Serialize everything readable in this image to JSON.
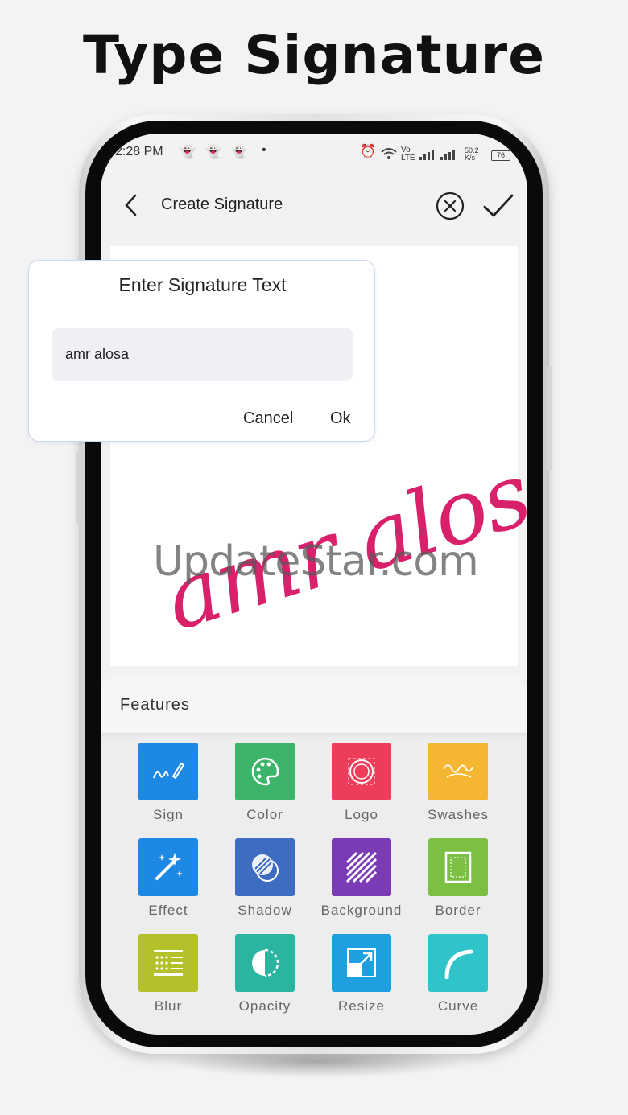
{
  "headline": "Type Signature",
  "status_bar": {
    "time": "2:28 PM",
    "dot": "•",
    "network": "Vo LTE",
    "speed": "50.2 K/s",
    "battery": "76"
  },
  "app_bar": {
    "title": "Create Signature"
  },
  "signature": {
    "text": "amr alosa",
    "color": "#d9216b"
  },
  "watermark": "UpdateStar.com",
  "dialog": {
    "title": "Enter Signature Text",
    "input_value": "amr alosa",
    "cancel_label": "Cancel",
    "ok_label": "Ok"
  },
  "features": {
    "title": "Features",
    "items": [
      {
        "label": "Sign",
        "color": "#1e88e5",
        "icon": "pen-signature-icon"
      },
      {
        "label": "Color",
        "color": "#3cb56b",
        "icon": "palette-icon"
      },
      {
        "label": "Logo",
        "color": "#ee3d5a",
        "icon": "logo-badge-icon"
      },
      {
        "label": "Swashes",
        "color": "#f5b731",
        "icon": "swash-icon"
      },
      {
        "label": "Effect",
        "color": "#1e88e5",
        "icon": "magic-wand-icon"
      },
      {
        "label": "Shadow",
        "color": "#3d6cc0",
        "icon": "shadow-circle-icon"
      },
      {
        "label": "Background",
        "color": "#7a3bb5",
        "icon": "stripes-icon"
      },
      {
        "label": "Border",
        "color": "#7cc043",
        "icon": "border-frame-icon"
      },
      {
        "label": "Blur",
        "color": "#b5c12b",
        "icon": "blur-grid-icon"
      },
      {
        "label": "Opacity",
        "color": "#2bb5a0",
        "icon": "half-circle-icon"
      },
      {
        "label": "Resize",
        "color": "#1e9fe0",
        "icon": "resize-arrow-icon"
      },
      {
        "label": "Curve",
        "color": "#2ec4c9",
        "icon": "curve-arc-icon"
      }
    ]
  }
}
